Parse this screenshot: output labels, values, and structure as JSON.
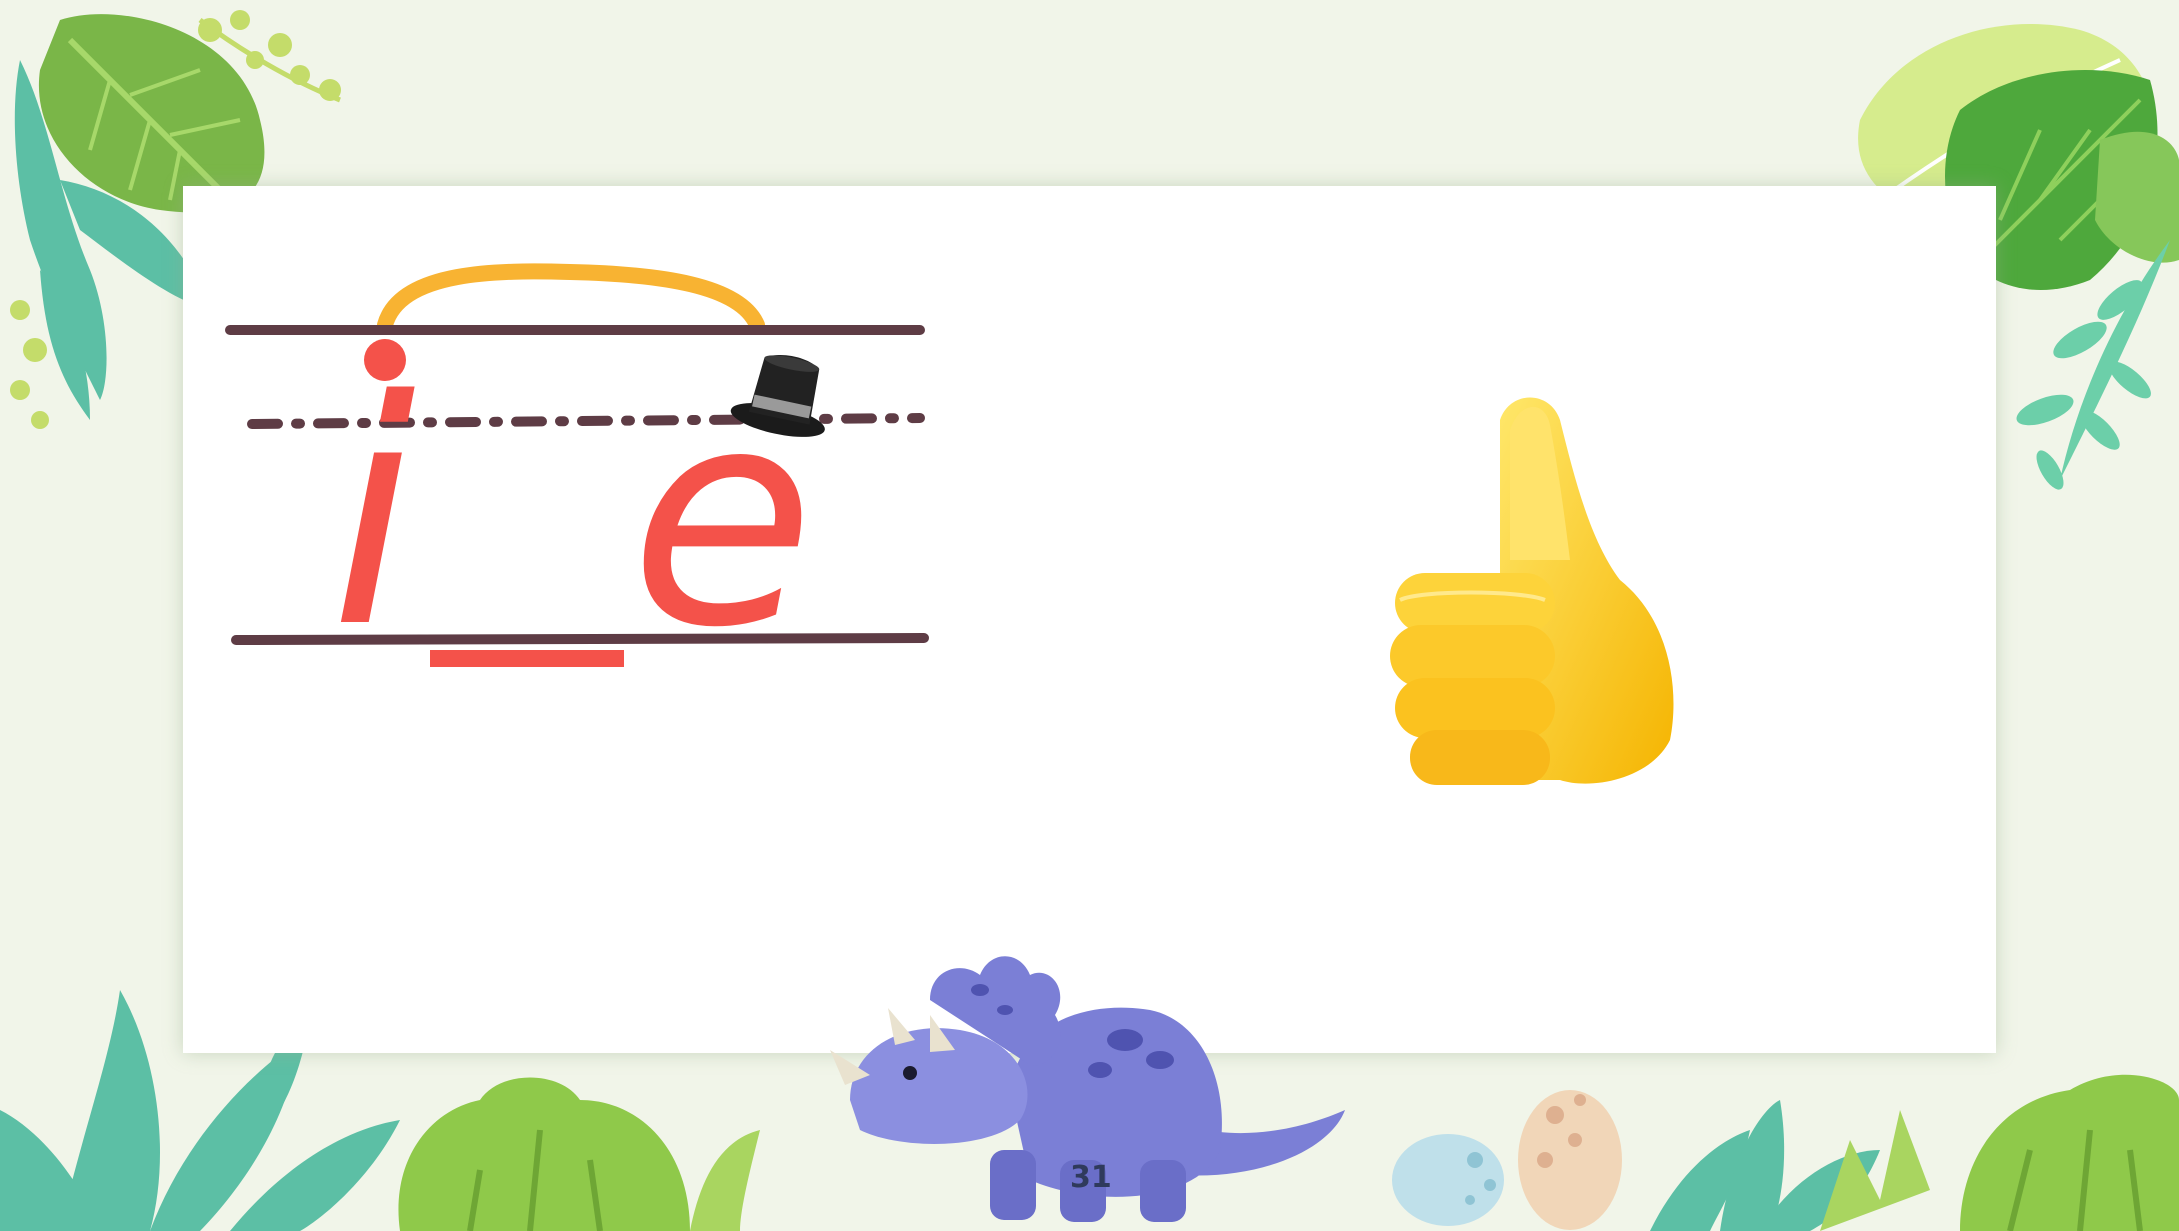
{
  "slide": {
    "page_number": "31"
  },
  "phonics": {
    "letter_first": "i",
    "letter_second": "e",
    "pattern": "i_e",
    "accent_color": "#f4524a",
    "arc_color": "#f8b332",
    "guideline_color": "#5e3c45"
  },
  "icons": {
    "thumb": "thumbs-up-icon",
    "hat": "top-hat-icon",
    "dino": "triceratops-illustration"
  }
}
